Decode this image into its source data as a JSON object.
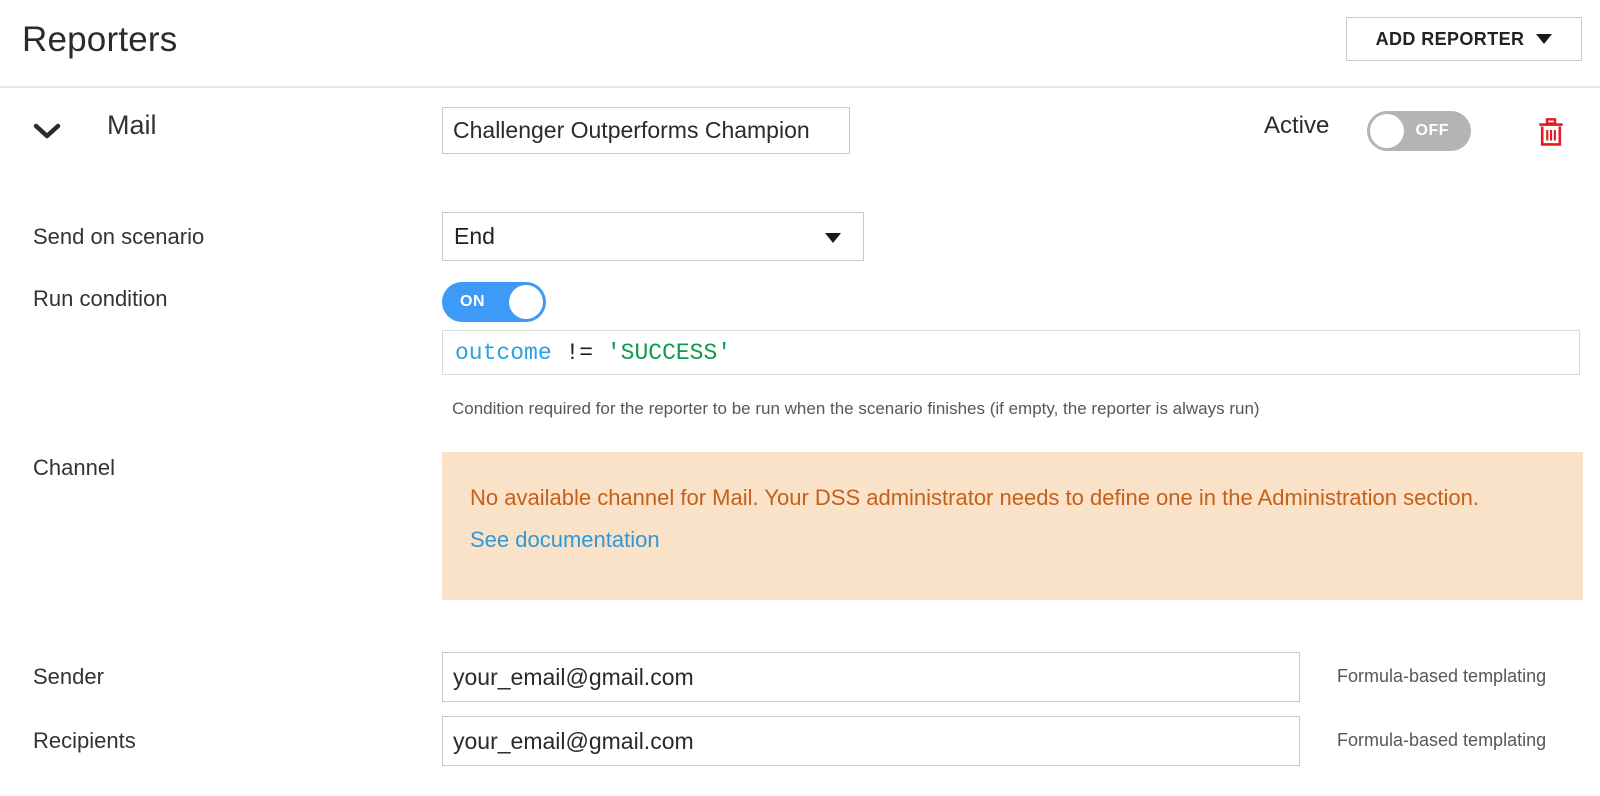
{
  "header": {
    "title": "Reporters",
    "add_reporter_label": "ADD REPORTER",
    "caret_icon": "chevron-down-icon"
  },
  "reporter": {
    "collapse_icon": "chevron-down-icon",
    "type": "Mail",
    "name_value": "Challenger Outperforms Champion",
    "name_placeholder": "",
    "active_label": "Active",
    "active_state": "OFF",
    "delete_icon": "trash-icon"
  },
  "fields": {
    "send_on_scenario": {
      "label": "Send on scenario",
      "value": "End"
    },
    "run_condition": {
      "label": "Run condition",
      "toggle_state": "ON",
      "code": {
        "variable": "outcome",
        "operator": "!=",
        "string": "'SUCCESS'"
      },
      "help": "Condition required for the reporter to be run when the scenario finishes (if empty, the reporter is always run)"
    },
    "channel": {
      "label": "Channel",
      "alert_message": "No available channel for Mail. Your DSS administrator needs to define one in the Administration section.",
      "alert_link": "See documentation"
    },
    "sender": {
      "label": "Sender",
      "value": "your_email@gmail.com",
      "hint": "Formula-based templating"
    },
    "recipients": {
      "label": "Recipients",
      "value": "your_email@gmail.com",
      "hint": "Formula-based templating"
    }
  },
  "colors": {
    "toggle_on": "#3d9bf7",
    "toggle_off": "#b4b4b4",
    "alert_bg": "#fae2c8",
    "alert_text": "#c4601a",
    "link": "#2d9ad6",
    "delete": "#e01b24",
    "code_var": "#29a3e0",
    "code_string": "#0d9b4f"
  }
}
